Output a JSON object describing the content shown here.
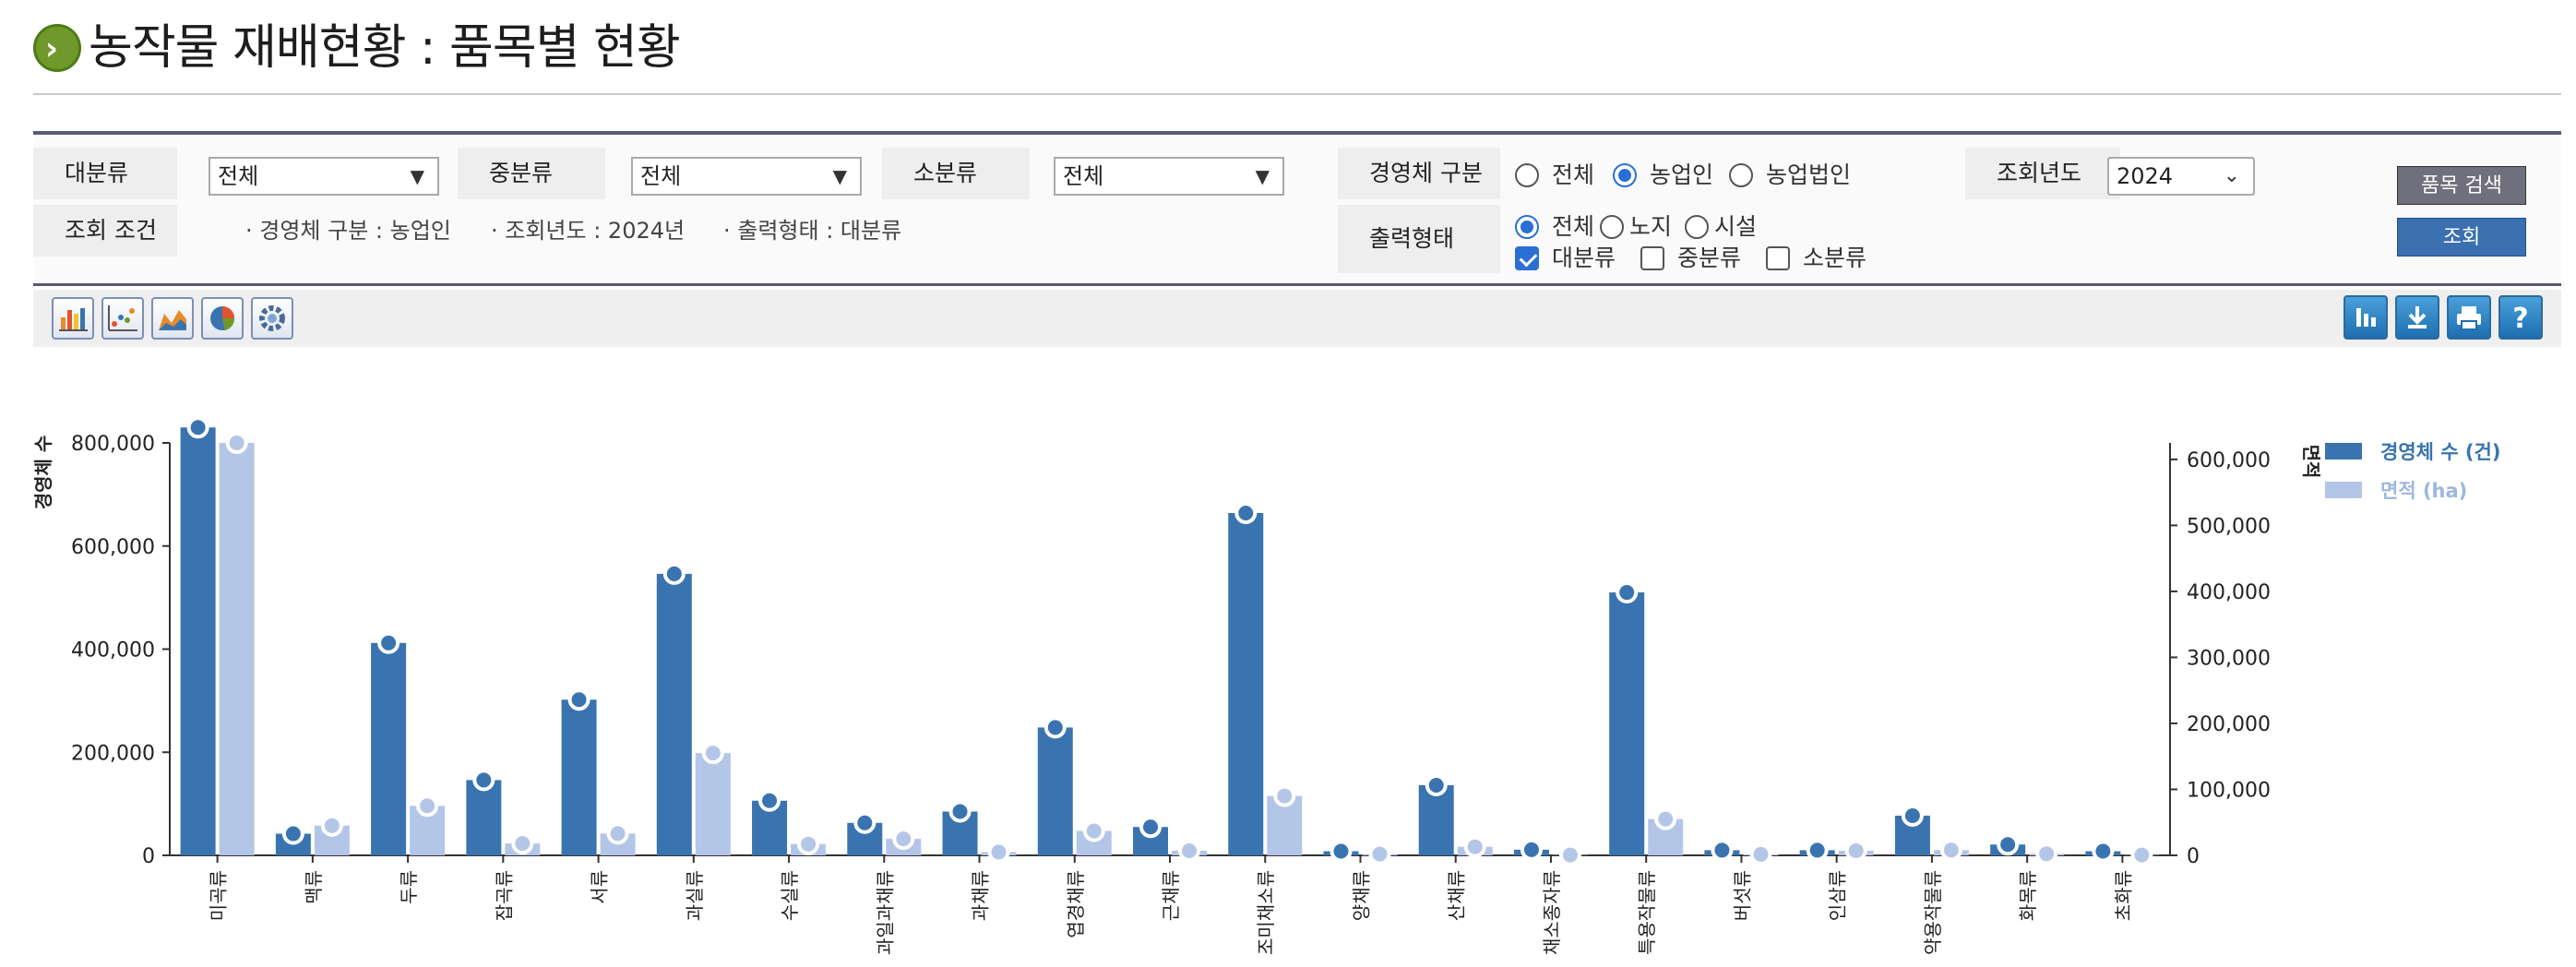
{
  "page": {
    "title": "농작물 재배현황 : 품목별 현황"
  },
  "filters": {
    "major_label": "대분류",
    "major_value": "전체",
    "middle_label": "중분류",
    "middle_value": "전체",
    "minor_label": "소분류",
    "minor_value": "전체",
    "biz_type_label": "경영체 구분",
    "biz_type_options": [
      "전체",
      "농업인",
      "농업법인"
    ],
    "biz_type_selected": "농업인",
    "year_label": "조회년도",
    "year_value": "2024",
    "condition_label": "조회 조건",
    "condition_items": [
      "· 경영체 구분 : 농업인",
      "· 조회년도 : 2024년",
      "· 출력형태 : 대분류"
    ],
    "output_label": "출력형태",
    "output_radio_options": [
      "전체",
      "노지",
      "시설"
    ],
    "output_radio_selected": "전체",
    "output_check_options": [
      "대분류",
      "중분류",
      "소분류"
    ],
    "output_check_checked": [
      "대분류"
    ],
    "item_search_button": "품목 검색",
    "search_button": "조회"
  },
  "toolbar": {
    "left_icons": [
      "bar-chart-icon",
      "scatter-chart-icon",
      "area-chart-icon",
      "pie-chart-icon",
      "settings-icon"
    ],
    "right_icons": [
      "column-chart-icon",
      "download-icon",
      "print-icon",
      "help-icon"
    ]
  },
  "colors": {
    "accent": "#3a74b0",
    "series1": "#3a74b0",
    "series2": "#b4c6e7",
    "legend2_text": "#9db7dc"
  },
  "chart_data": {
    "type": "bar",
    "ylabel": "경영체 수",
    "y2label": "면적",
    "ylim": [
      0,
      800000
    ],
    "y2lim": [
      0,
      625000
    ],
    "yticks": [
      "800,000",
      "600,000",
      "400,000",
      "200,000",
      "0"
    ],
    "y2ticks": [
      "600,000",
      "500,000",
      "400,000",
      "300,000",
      "200,000",
      "100,000",
      "0"
    ],
    "legend_position": "top-right",
    "categories": [
      "미곡류",
      "맥류",
      "두류",
      "잡곡류",
      "서류",
      "과실류",
      "수실류",
      "과일과채류",
      "과채류",
      "엽경채류",
      "근채류",
      "조미채소류",
      "양채류",
      "산채류",
      "채소종자류",
      "특용작물류",
      "버섯류",
      "인삼류",
      "약용작물류",
      "화목류",
      "초화류"
    ],
    "series": [
      {
        "name": "경영체 수 (건)",
        "axis": "left",
        "values": [
          830000,
          42000,
          412000,
          146000,
          302000,
          546000,
          106000,
          63000,
          85000,
          248000,
          55000,
          664000,
          8000,
          136000,
          11000,
          510000,
          10000,
          10000,
          77000,
          21000,
          8000
        ]
      },
      {
        "name": "면적 (ha)",
        "axis": "right",
        "values": [
          630000,
          45000,
          75000,
          18000,
          33000,
          155000,
          17000,
          25000,
          5000,
          37000,
          7000,
          90000,
          2000,
          13000,
          500,
          55000,
          1500,
          7000,
          8000,
          2500,
          500
        ]
      }
    ]
  }
}
